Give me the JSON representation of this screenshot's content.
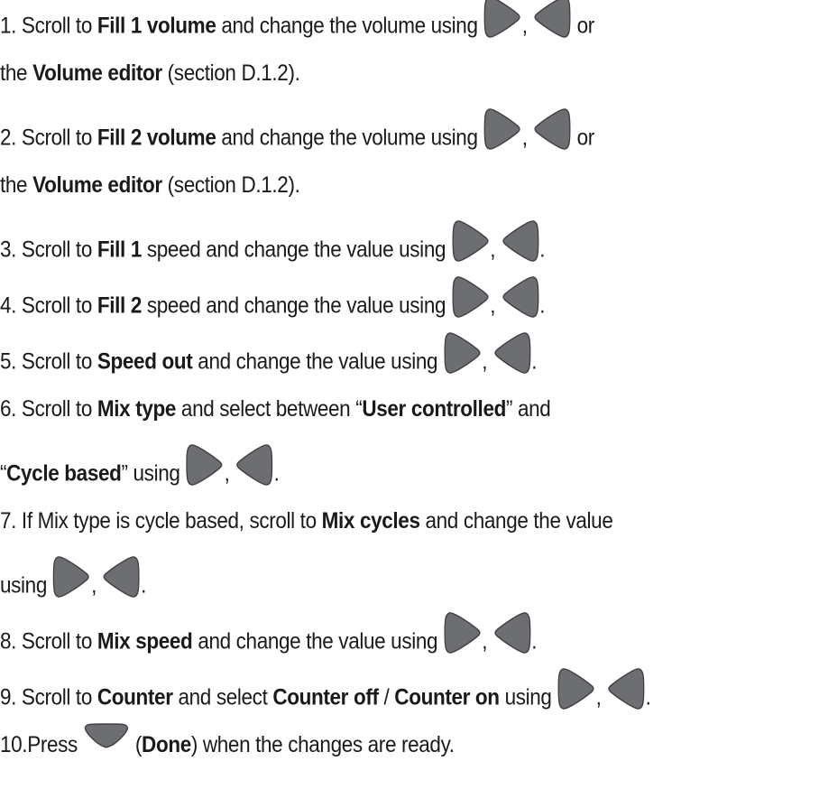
{
  "steps": [
    {
      "parts": [
        {
          "t": "1.  Scroll to "
        },
        {
          "t": "Fill 1 volume",
          "b": true
        },
        {
          "t": " and change the volume using "
        },
        {
          "icon": "right-arrow-icon"
        },
        {
          "t": ", "
        },
        {
          "icon": "left-arrow-icon"
        },
        {
          "t": " or"
        }
      ]
    },
    {
      "parts": [
        {
          "t": "the "
        },
        {
          "t": "Volume editor",
          "b": true
        },
        {
          "t": " (section D.1.2)."
        }
      ]
    },
    {
      "parts": [
        {
          "t": "2.  Scroll to "
        },
        {
          "t": "Fill 2 volume",
          "b": true
        },
        {
          "t": " and change the volume using "
        },
        {
          "icon": "right-arrow-icon"
        },
        {
          "t": ", "
        },
        {
          "icon": "left-arrow-icon"
        },
        {
          "t": " or"
        }
      ]
    },
    {
      "parts": [
        {
          "t": "the "
        },
        {
          "t": "Volume editor",
          "b": true
        },
        {
          "t": " (section D.1.2)."
        }
      ]
    },
    {
      "parts": [
        {
          "t": "3.  Scroll to "
        },
        {
          "t": "Fill 1",
          "b": true
        },
        {
          "t": " speed and change the value using "
        },
        {
          "icon": "right-arrow-icon"
        },
        {
          "t": ", "
        },
        {
          "icon": "left-arrow-icon"
        },
        {
          "t": "."
        }
      ]
    },
    {
      "parts": [
        {
          "t": "4.  Scroll to "
        },
        {
          "t": "Fill 2",
          "b": true
        },
        {
          "t": " speed and change the value using "
        },
        {
          "icon": "right-arrow-icon"
        },
        {
          "t": ", "
        },
        {
          "icon": "left-arrow-icon"
        },
        {
          "t": "."
        }
      ]
    },
    {
      "parts": [
        {
          "t": "5.  Scroll to "
        },
        {
          "t": "Speed out",
          "b": true
        },
        {
          "t": " and change the value using "
        },
        {
          "icon": "right-arrow-icon"
        },
        {
          "t": ", "
        },
        {
          "icon": "left-arrow-icon"
        },
        {
          "t": "."
        }
      ]
    },
    {
      "parts": [
        {
          "t": "6.  Scroll to "
        },
        {
          "t": "Mix type",
          "b": true
        },
        {
          "t": " and select between “"
        },
        {
          "t": "User controlled",
          "b": true
        },
        {
          "t": "” and"
        }
      ]
    },
    {
      "parts": [
        {
          "t": "“"
        },
        {
          "t": "Cycle based",
          "b": true
        },
        {
          "t": "” using "
        },
        {
          "icon": "right-arrow-icon"
        },
        {
          "t": ", "
        },
        {
          "icon": "left-arrow-icon"
        },
        {
          "t": "."
        }
      ]
    },
    {
      "parts": [
        {
          "t": "7.  If Mix type is cycle based, scroll to "
        },
        {
          "t": "Mix cycles",
          "b": true
        },
        {
          "t": " and change the value"
        }
      ]
    },
    {
      "parts": [
        {
          "t": "using "
        },
        {
          "icon": "right-arrow-icon"
        },
        {
          "t": ", "
        },
        {
          "icon": "left-arrow-icon"
        },
        {
          "t": "."
        }
      ]
    },
    {
      "parts": [
        {
          "t": "8.  Scroll to "
        },
        {
          "t": "Mix speed",
          "b": true
        },
        {
          "t": " and change the value using "
        },
        {
          "icon": "right-arrow-icon"
        },
        {
          "t": ", "
        },
        {
          "icon": "left-arrow-icon"
        },
        {
          "t": "."
        }
      ]
    },
    {
      "parts": [
        {
          "t": "9.  Scroll to "
        },
        {
          "t": "Counter",
          "b": true
        },
        {
          "t": " and select "
        },
        {
          "t": "Counter off",
          "b": true
        },
        {
          "t": " / "
        },
        {
          "t": "Counter on",
          "b": true
        },
        {
          "t": " using "
        },
        {
          "icon": "right-arrow-icon"
        },
        {
          "t": ", "
        },
        {
          "icon": "left-arrow-icon"
        },
        {
          "t": "."
        }
      ]
    },
    {
      "parts": [
        {
          "t": "10.Press "
        },
        {
          "icon": "down-arrow-icon"
        },
        {
          "t": " ("
        },
        {
          "t": "Done",
          "b": true
        },
        {
          "t": ") when the changes are ready."
        }
      ]
    }
  ],
  "colors": {
    "text": "#1a1a1a",
    "button_fill": "#6d6e71",
    "button_edge": "#3f4042"
  }
}
